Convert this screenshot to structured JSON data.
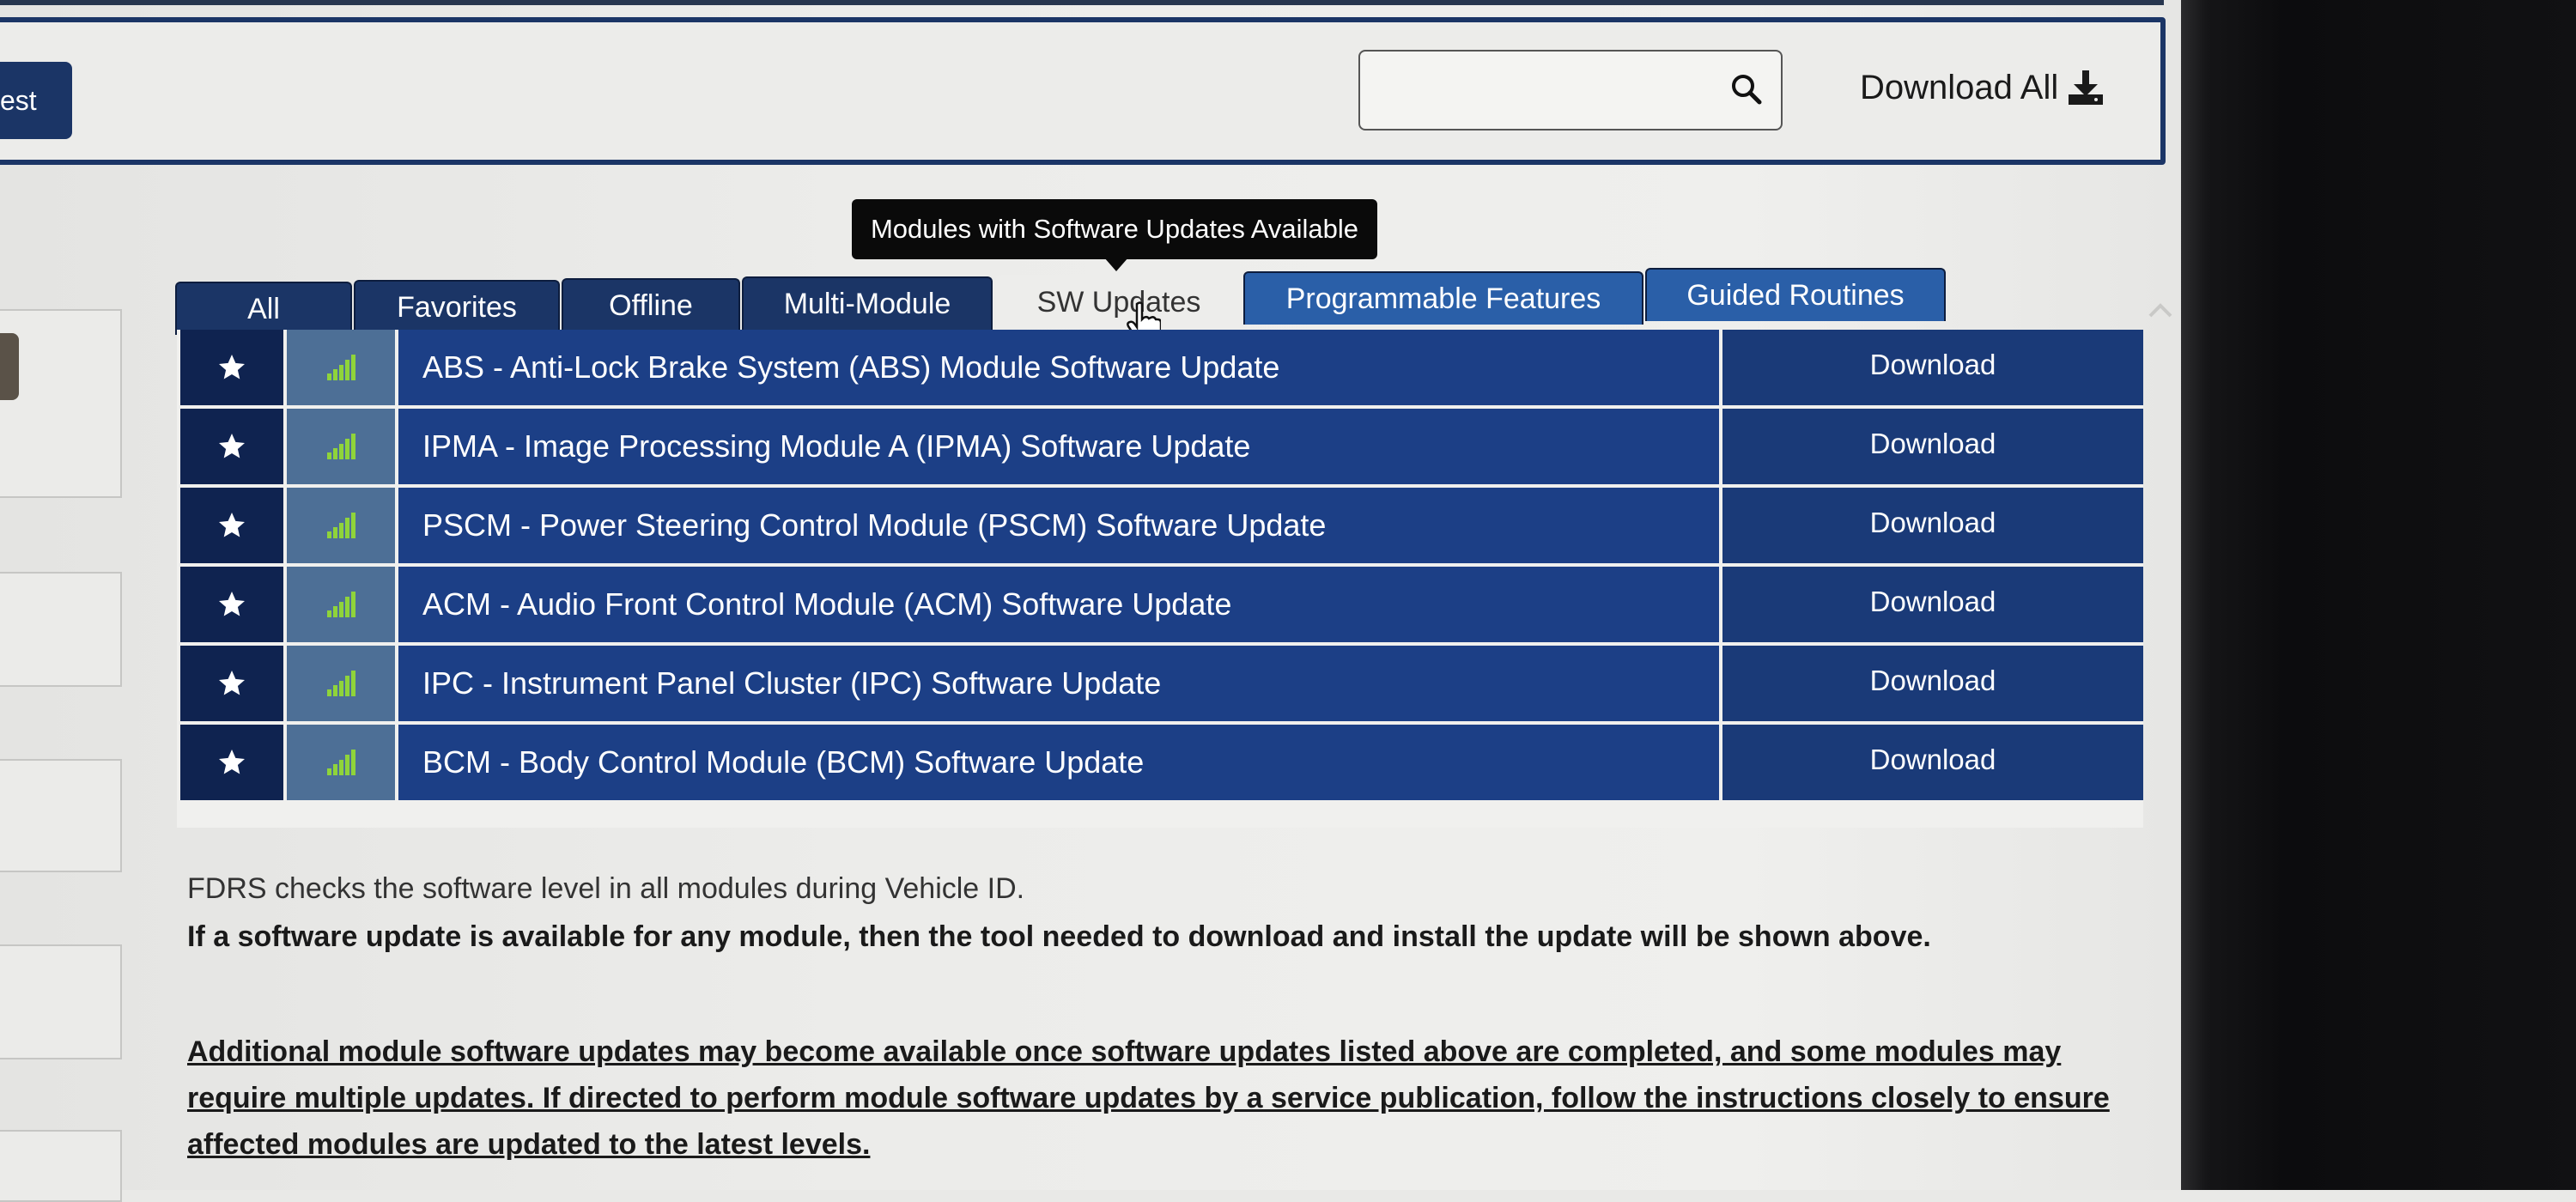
{
  "header": {
    "test_button_label": "est",
    "search": {
      "value": "",
      "placeholder": ""
    },
    "download_all_label": "Download All"
  },
  "tooltip": "Modules with Software Updates Available",
  "tabs": [
    {
      "label": "All",
      "active": false
    },
    {
      "label": "Favorites",
      "active": false
    },
    {
      "label": "Offline",
      "active": false
    },
    {
      "label": "Multi-Module",
      "active": false
    },
    {
      "label": "SW Updates",
      "active": true
    },
    {
      "label": "Programmable Features",
      "active": false
    },
    {
      "label": "Guided Routines",
      "active": false
    }
  ],
  "modules": [
    {
      "name": "ABS - Anti-Lock Brake System (ABS) Module Software Update",
      "action": "Download"
    },
    {
      "name": "IPMA - Image Processing Module A (IPMA) Software Update",
      "action": "Download"
    },
    {
      "name": "PSCM - Power Steering Control Module (PSCM) Software Update",
      "action": "Download"
    },
    {
      "name": "ACM - Audio Front Control Module (ACM) Software Update",
      "action": "Download"
    },
    {
      "name": "IPC - Instrument Panel Cluster (IPC) Software Update",
      "action": "Download"
    },
    {
      "name": "BCM - Body Control Module (BCM) Software Update",
      "action": "Download"
    }
  ],
  "notes": {
    "line1": "FDRS checks the software level in all modules during Vehicle ID.",
    "line2": "If a software update is available for any module, then the tool needed to download and install the update will be shown above.",
    "line3": "Additional module software updates may become available once software updates listed above are completed, and some modules may require multiple updates. If directed to perform module software updates by a service publication, follow the instructions closely to ensure affected modules are updated to the latest levels."
  },
  "colors": {
    "navy": "#1b3566",
    "row_blue": "#1c3f86",
    "signal_green": "#8fd43a"
  },
  "icons": {
    "search": "search-icon",
    "download": "download-icon",
    "favorite": "star-icon",
    "signal": "signal-bars-icon",
    "cursor": "hand-pointer-icon"
  }
}
